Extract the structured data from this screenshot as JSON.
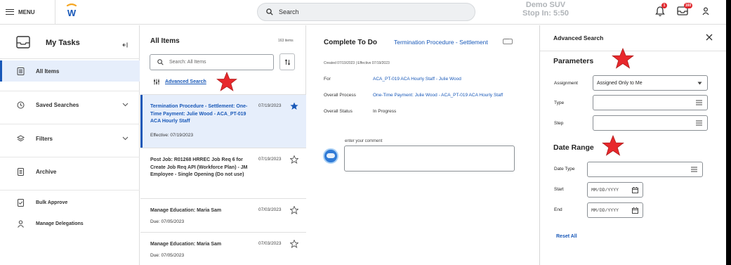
{
  "topbar": {
    "menu_label": "MENU",
    "search_label": "Search",
    "demo_line1": "Demo SUV",
    "demo_line2": "Stop In: 5:50",
    "notifications_count": "1",
    "inbox_count": "160",
    "logo_letter": "W"
  },
  "sidebar": {
    "title": "My Tasks",
    "items": [
      {
        "label": "All Items",
        "icon": "list-icon",
        "active": true
      },
      {
        "label": "Saved Searches",
        "icon": "history-icon"
      },
      {
        "label": "Filters",
        "icon": "layers-icon"
      },
      {
        "label": "Archive",
        "icon": "archive-icon"
      },
      {
        "label": "Bulk Approve",
        "icon": "checklist-icon"
      },
      {
        "label": "Manage Delegations",
        "icon": "person-icon"
      }
    ]
  },
  "list": {
    "title": "All Items",
    "count": "163 items",
    "search_placeholder": "Search: All Items",
    "advanced_search": "Advanced Search",
    "rows": [
      {
        "title": "Termination Procedure - Settlement: One-Time Payment: Julie Wood - ACA_PT-019 ACA Hourly Staff",
        "date": "07/19/2023",
        "sub": "Effective: 07/19/2023",
        "starred": true
      },
      {
        "title": "Post Job: R01268 HRREC Job Req 6 for Create Job Req API (Workforce Plan) - JM Employee - Single Opening (Do not use)",
        "date": "07/19/2023",
        "sub": "",
        "starred": false
      },
      {
        "title": "Manage Education: Maria Sam",
        "date": "07/03/2023",
        "sub": "Due: 07/05/2023",
        "starred": false
      },
      {
        "title": "Manage Education: Maria Sam",
        "date": "07/03/2023",
        "sub": "Due: 07/05/2023",
        "starred": false
      }
    ]
  },
  "detail": {
    "heading": "Complete To Do",
    "link": "Termination Procedure - Settlement",
    "created": "Created 07/19/2023 | Effective 07/19/2023",
    "fields": [
      {
        "label": "For",
        "value": "ACA_PT-019 ACA Hourly Staff - Julie Wood"
      },
      {
        "label": "Overall Process",
        "value": "One-Time Payment: Julie Wood - ACA_PT-019 ACA Hourly Staff"
      },
      {
        "label": "Overall Status",
        "value": "In Progress"
      }
    ],
    "comment_label": "enter your comment"
  },
  "advanced_search": {
    "title": "Advanced Search",
    "parameters_title": "Parameters",
    "assignment_label": "Assignment",
    "assignment_value": "Assigned Only to Me",
    "type_label": "Type",
    "step_label": "Step",
    "date_range_title": "Date Range",
    "date_type_label": "Date Type",
    "start_label": "Start",
    "start_placeholder": "MM/DD/YYYY",
    "end_label": "End",
    "end_placeholder": "MM/DD/YYYY",
    "reset_label": "Reset All"
  },
  "colors": {
    "accent": "#1858b8",
    "selected_bg": "#e6eefb",
    "annotation_star": "#e8282c",
    "badge": "#e0282e"
  }
}
